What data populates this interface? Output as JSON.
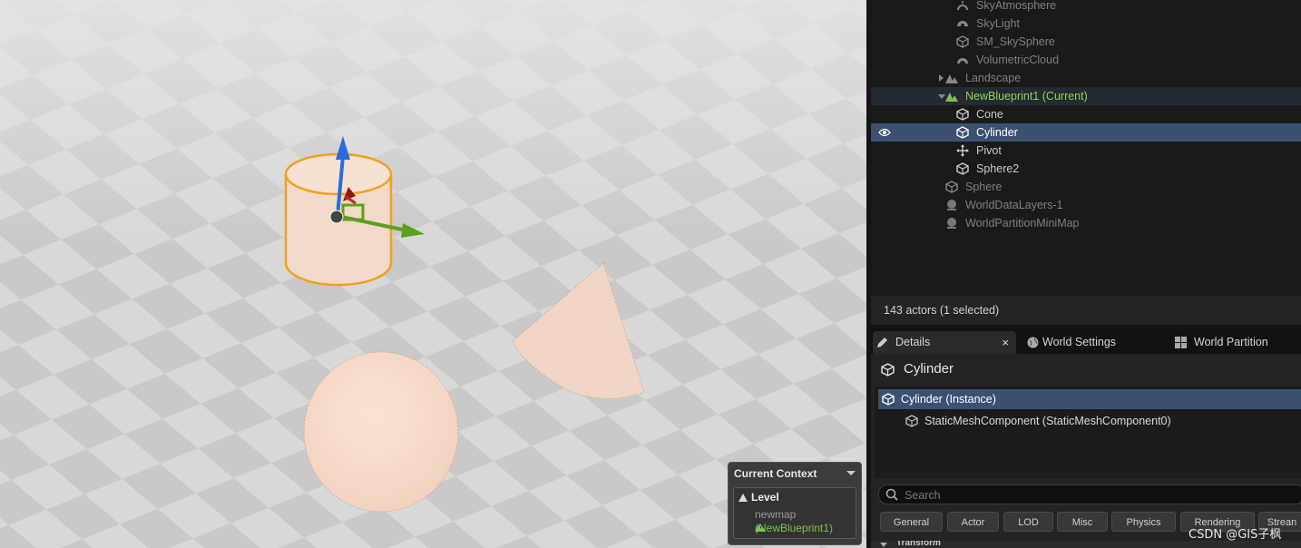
{
  "outliner": {
    "rows": [
      {
        "label": "SkyAtmosphere",
        "icon": "sky-atmosphere-icon",
        "dim": true
      },
      {
        "label": "SkyLight",
        "icon": "skylight-icon",
        "dim": true
      },
      {
        "label": "SM_SkySphere",
        "icon": "static-mesh-icon",
        "dim": true
      },
      {
        "label": "VolumetricCloud",
        "icon": "cloud-icon",
        "dim": true
      },
      {
        "label": "Landscape",
        "icon": "landscape-icon",
        "dim": true
      },
      {
        "label": "NewBlueprint1 (Current)",
        "icon": "level-instance-icon",
        "current": true
      },
      {
        "label": "Cone",
        "icon": "static-mesh-icon"
      },
      {
        "label": "Cylinder",
        "icon": "static-mesh-icon",
        "selected": true
      },
      {
        "label": "Pivot",
        "icon": "pivot-icon"
      },
      {
        "label": "Sphere2",
        "icon": "static-mesh-icon"
      },
      {
        "label": "Sphere",
        "icon": "static-mesh-icon",
        "dim": true
      },
      {
        "label": "WorldDataLayers-1",
        "icon": "world-data-layers-icon",
        "dim": true
      },
      {
        "label": "WorldPartitionMiniMap",
        "icon": "minimap-icon",
        "dim": true
      }
    ]
  },
  "status": {
    "actors_text": "143 actors (1 selected)"
  },
  "tabs": {
    "details": "Details",
    "world_settings": "World Settings",
    "world_partition": "World Partition",
    "close": "×"
  },
  "details": {
    "title": "Cylinder",
    "components": [
      {
        "label": "Cylinder (Instance)",
        "selected": true
      },
      {
        "label": "StaticMeshComponent (StaticMeshComponent0)"
      }
    ],
    "search_placeholder": "Search",
    "filters": [
      "General",
      "Actor",
      "LOD",
      "Misc",
      "Physics",
      "Rendering",
      "Strean"
    ],
    "transform_label": "Transform"
  },
  "context": {
    "header": "Current Context",
    "level": "Level",
    "map": "newmap",
    "bp_open": "(",
    "blueprint": "NewBlueprint1",
    "bp_close": ")"
  },
  "watermark": "CSDN @GIS子枫",
  "colors": {
    "selection": "#3a5172",
    "current_level_text": "#8fd34f",
    "gizmo_x": "#c0281e",
    "gizmo_y": "#5aa11c",
    "gizmo_z": "#2a6bd6",
    "selection_outline": "#f0a020"
  }
}
